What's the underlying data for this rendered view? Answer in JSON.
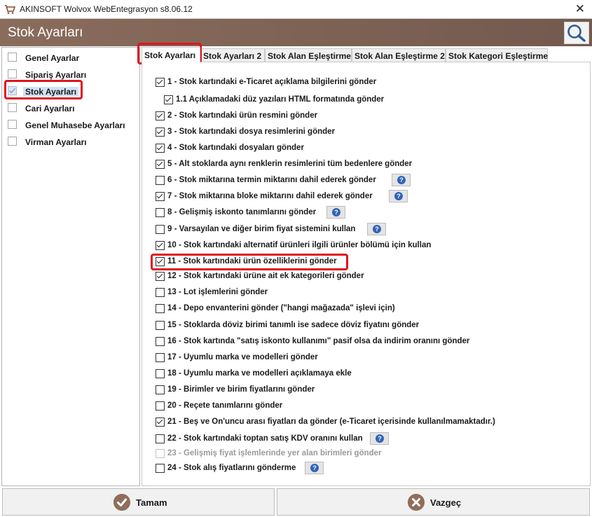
{
  "window": {
    "title": "AKINSOFT Wolvox WebEntegrasyon s8.06.12",
    "close_symbol": "✕"
  },
  "header": {
    "title": "Stok Ayarları"
  },
  "sidebar": {
    "items": [
      {
        "label": "Genel Ayarlar",
        "checked": false,
        "selected": false
      },
      {
        "label": "Sipariş Ayarları",
        "checked": false,
        "selected": false
      },
      {
        "label": "Stok Ayarları",
        "checked": true,
        "selected": true
      },
      {
        "label": "Cari Ayarları",
        "checked": false,
        "selected": false
      },
      {
        "label": "Genel Muhasebe Ayarları",
        "checked": false,
        "selected": false
      },
      {
        "label": "Virman Ayarları",
        "checked": false,
        "selected": false
      }
    ]
  },
  "tabs": [
    {
      "label": "Stok Ayarları",
      "active": true
    },
    {
      "label": "Stok Ayarları 2",
      "active": false
    },
    {
      "label": "Stok Alan Eşleştirme",
      "active": false
    },
    {
      "label": "Stok Alan Eşleştirme 2",
      "active": false
    },
    {
      "label": "Stok Kategori Eşleştirme",
      "active": false
    }
  ],
  "options": [
    {
      "label": "1 - Stok kartındaki e-Ticaret açıklama bilgilerini gönder",
      "checked": true
    },
    {
      "label": "1.1 Açıklamadaki düz yazıları HTML formatında gönder",
      "checked": true
    },
    {
      "label": "2 - Stok kartındaki ürün resmini gönder",
      "checked": true
    },
    {
      "label": "3 - Stok kartındaki dosya resimlerini gönder",
      "checked": true
    },
    {
      "label": "4 - Stok kartındaki dosyaları gönder",
      "checked": true
    },
    {
      "label": "5 - Alt stoklarda aynı renklerin resimlerini tüm bedenlere gönder",
      "checked": true
    },
    {
      "label": "6 - Stok miktarına termin miktarını dahil ederek gönder",
      "checked": false,
      "help": true
    },
    {
      "label": "7 - Stok miktarına bloke miktarını dahil ederek gönder",
      "checked": true,
      "help": true
    },
    {
      "label": "8 - Gelişmiş iskonto tanımlarını gönder",
      "checked": false,
      "help": true
    },
    {
      "label": "9 - Varsayılan ve diğer birim fiyat sistemini kullan",
      "checked": false,
      "help": true
    },
    {
      "label": "10 - Stok kartındaki alternatif ürünleri ilgili ürünler bölümü için kullan",
      "checked": true
    },
    {
      "label": "11 - Stok kartındaki ürün özelliklerini gönder",
      "checked": true
    },
    {
      "label": "12 - Stok kartındaki ürüne ait ek kategorileri gönder",
      "checked": true
    },
    {
      "label": "13 - Lot işlemlerini gönder",
      "checked": false
    },
    {
      "label": "14 - Depo envanterini gönder (\"hangi mağazada\" işlevi için)",
      "checked": false
    },
    {
      "label": "15 - Stoklarda döviz birimi tanımlı ise sadece döviz fiyatını gönder",
      "checked": false
    },
    {
      "label": "16 - Stok kartında \"satış iskonto kullanımı\" pasif olsa da indirim oranını gönder",
      "checked": false
    },
    {
      "label": "17 - Uyumlu marka ve modelleri gönder",
      "checked": false
    },
    {
      "label": "18 - Uyumlu marka ve modelleri açıklamaya ekle",
      "checked": false
    },
    {
      "label": "19 - Birimler ve birim fiyatlarını gönder",
      "checked": false
    },
    {
      "label": "20 - Reçete tanımlarını gönder",
      "checked": false
    },
    {
      "label": "21 - Beş ve On'uncu arası fiyatları da gönder (e-Ticaret içerisinde kullanılmamaktadır.)",
      "checked": true
    },
    {
      "label": "22 - Stok kartındaki toptan satış KDV oranını kullan",
      "checked": false,
      "help": true
    },
    {
      "label": "23 - Gelişmiş fiyat işlemlerinde yer alan birimleri gönder",
      "checked": false,
      "disabled": true
    },
    {
      "label": "24 - Stok alış fiyatlarını gönderme",
      "checked": false,
      "help": true
    }
  ],
  "help_symbol": "?",
  "footer": {
    "ok_label": "Tamam",
    "cancel_label": "Vazgeç"
  },
  "colors": {
    "header_brand": "#7d6355",
    "highlight": "#e0141e",
    "help_icon": "#2f64b8"
  }
}
